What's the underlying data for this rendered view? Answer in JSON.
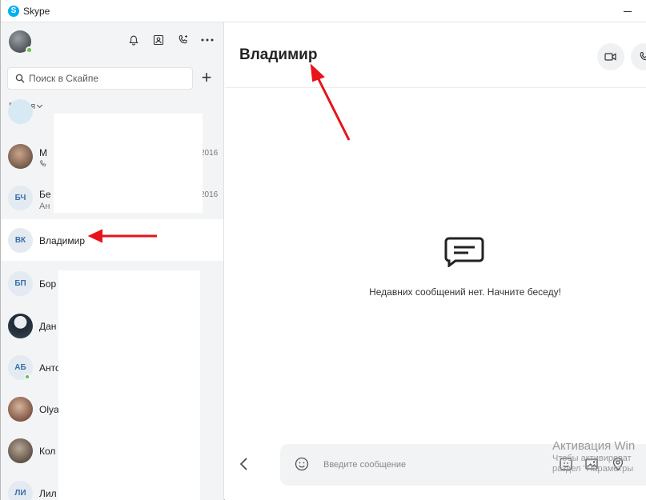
{
  "window": {
    "title": "Skype",
    "app_icon_letter": "S"
  },
  "sidebar": {
    "search_placeholder": "Поиск в Скайпе",
    "add_label": "+",
    "sort_label": "Время",
    "contacts": [
      {
        "initials": "",
        "name": "М",
        "sub": "",
        "date": "2016"
      },
      {
        "initials": "БЧ",
        "name": "Бе",
        "sub": "Ан",
        "date": "2016"
      },
      {
        "initials": "ВК",
        "name": "Владимир",
        "sub": "",
        "date": ""
      },
      {
        "initials": "БП",
        "name": "Бор",
        "sub": "",
        "date": ""
      },
      {
        "initials": "",
        "name": "Дан",
        "sub": "",
        "date": ""
      },
      {
        "initials": "АБ",
        "name": "Анто",
        "sub": "",
        "date": ""
      },
      {
        "initials": "",
        "name": "Olya",
        "sub": "",
        "date": ""
      },
      {
        "initials": "",
        "name": "Кол",
        "sub": "",
        "date": ""
      },
      {
        "initials": "ЛИ",
        "name": "Лил",
        "sub": "",
        "date": ""
      }
    ]
  },
  "main": {
    "chat_title": "Владимир",
    "empty_message": "Недавних сообщений нет. Начните беседу!",
    "composer_placeholder": "Введите сообщение"
  },
  "watermark": {
    "title": "Активация Win",
    "line1": "Чтобы активироват",
    "line2": "раздел \"Параметры"
  },
  "colors": {
    "accent": "#00aff0",
    "annotation": "#e8131b",
    "online": "#6bbe45"
  }
}
